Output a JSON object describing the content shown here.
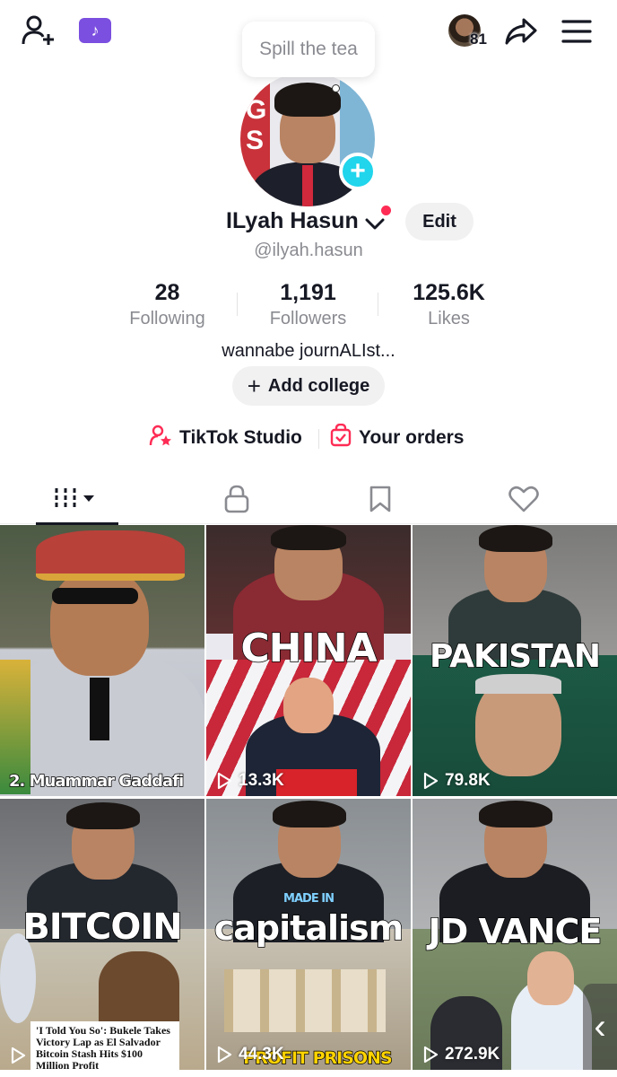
{
  "topbar": {
    "add_friend_icon": "person-plus-icon",
    "badge_icon": "tiktok-note-icon",
    "badge_glyph": "♪",
    "story_count": "81",
    "share_icon": "share-arrow-icon",
    "menu_icon": "hamburger-menu-icon"
  },
  "bubble": {
    "text": "Spill the tea"
  },
  "profile": {
    "name": "ILyah Hasun",
    "handle": "@ilyah.hasun",
    "edit_label": "Edit",
    "bio": "wannabe journALIst...",
    "college_label": "Add college"
  },
  "stats": [
    {
      "value": "28",
      "label": "Following"
    },
    {
      "value": "1,191",
      "label": "Followers"
    },
    {
      "value": "125.6K",
      "label": "Likes"
    }
  ],
  "links": {
    "studio": "TikTok Studio",
    "orders": "Your orders"
  },
  "tabs": [
    {
      "icon": "videos-grid-icon",
      "active": true
    },
    {
      "icon": "lock-icon",
      "active": false
    },
    {
      "icon": "bookmark-icon",
      "active": false
    },
    {
      "icon": "heart-icon",
      "active": false
    }
  ],
  "videos": [
    {
      "caption": "2. Muammar Gaddafi",
      "views": ""
    },
    {
      "caption": "CHINA",
      "views": "13.3K"
    },
    {
      "caption": "PAKISTAN",
      "views": "79.8K"
    },
    {
      "caption": "BITCOIN",
      "views": "",
      "headline": "'I Told You So': Bukele Takes Victory Lap as El Salvador Bitcoin Stash Hits $100 Million Profit"
    },
    {
      "caption": "capitalism",
      "views": "44.3K",
      "subcaption": "MADE IN",
      "bottom_caption": "PROFIT PRISONS"
    },
    {
      "caption": "JD VANCE",
      "views": "272.9K"
    }
  ],
  "colors": {
    "accent": "#fe2c55",
    "plus_button": "#20d5ec",
    "badge": "#7b4fe0",
    "muted_text": "#8a8b91"
  }
}
